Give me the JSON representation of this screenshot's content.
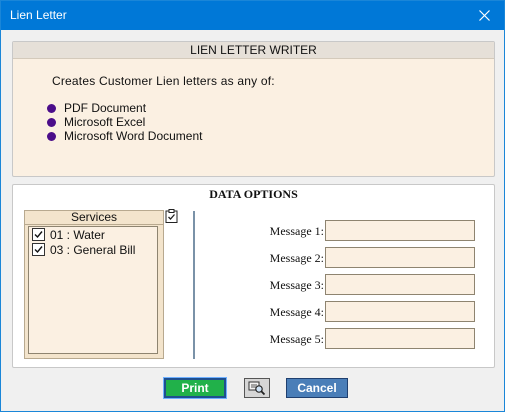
{
  "window": {
    "title": "Lien Letter"
  },
  "info": {
    "header": "LIEN LETTER WRITER",
    "description": "Creates Customer Lien letters as any of:",
    "formats": [
      "PDF Document",
      "Microsoft  Excel",
      "Microsoft  Word Document"
    ]
  },
  "data_options": {
    "title": "DATA OPTIONS",
    "services": {
      "header": "Services",
      "items": [
        {
          "label": "01 : Water",
          "checked": true
        },
        {
          "label": "03 : General Bill",
          "checked": true
        }
      ]
    },
    "messages": [
      {
        "label": "Message 1:",
        "value": ""
      },
      {
        "label": "Message 2:",
        "value": ""
      },
      {
        "label": "Message 3:",
        "value": ""
      },
      {
        "label": "Message 4:",
        "value": ""
      },
      {
        "label": "Message 5:",
        "value": ""
      }
    ]
  },
  "buttons": {
    "print": "Print",
    "cancel": "Cancel"
  },
  "colors": {
    "titlebar": "#0078d7",
    "info_bg": "#fbf0e2",
    "bullet": "#4b0d8a",
    "print_button": "#21b14a",
    "cancel_button": "#4a7eb8"
  },
  "icons": {
    "close": "close-icon",
    "bullet": "bullet-dot-icon",
    "select_all": "clipboard-check-icon",
    "preview": "print-preview-icon"
  }
}
